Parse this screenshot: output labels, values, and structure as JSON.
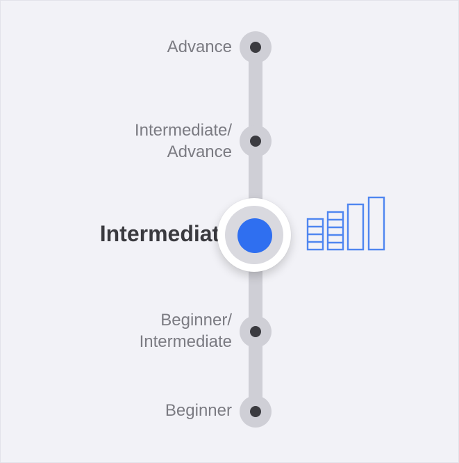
{
  "slider": {
    "levels": [
      {
        "line1": "Advance",
        "line2": ""
      },
      {
        "line1": "Intermediate/",
        "line2": "Advance"
      },
      {
        "line1": "Intermediate",
        "line2": ""
      },
      {
        "line1": "Beginner/",
        "line2": "Intermediate"
      },
      {
        "line1": "Beginner",
        "line2": ""
      }
    ],
    "selected_level": "Intermediate",
    "selected_index": 2,
    "icon": "level-bars-icon"
  },
  "colors": {
    "accent": "#2f6ff0",
    "icon_stroke": "#4f86f0",
    "track": "#cfcfd6",
    "dot": "#3b3b40",
    "label": "#7b7b82",
    "selected_label": "#3a3a3f",
    "background": "#f2f2f7"
  }
}
